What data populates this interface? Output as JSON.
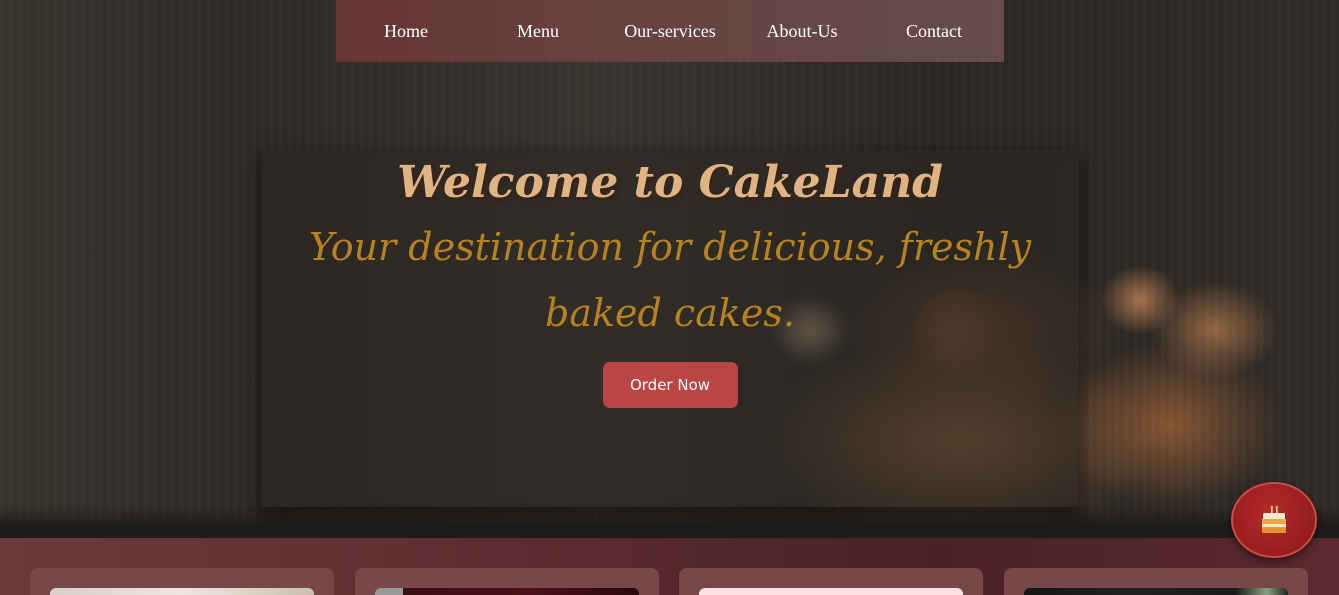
{
  "nav": {
    "items": [
      {
        "label": "Home"
      },
      {
        "label": "Menu"
      },
      {
        "label": "Our-services"
      },
      {
        "label": "About-Us"
      },
      {
        "label": "Contact"
      }
    ]
  },
  "hero": {
    "title": "Welcome to CakeLand",
    "subtitle": "Your destination for delicious, freshly baked cakes.",
    "order_button": "Order Now"
  },
  "floating_button": {
    "icon": "cake-icon"
  },
  "colors": {
    "title": "#e0b482",
    "subtitle": "#b8821e",
    "button": "#b94545",
    "nav": "#6e3737",
    "strip": "#5b2c2f",
    "fab": "#a52222"
  }
}
